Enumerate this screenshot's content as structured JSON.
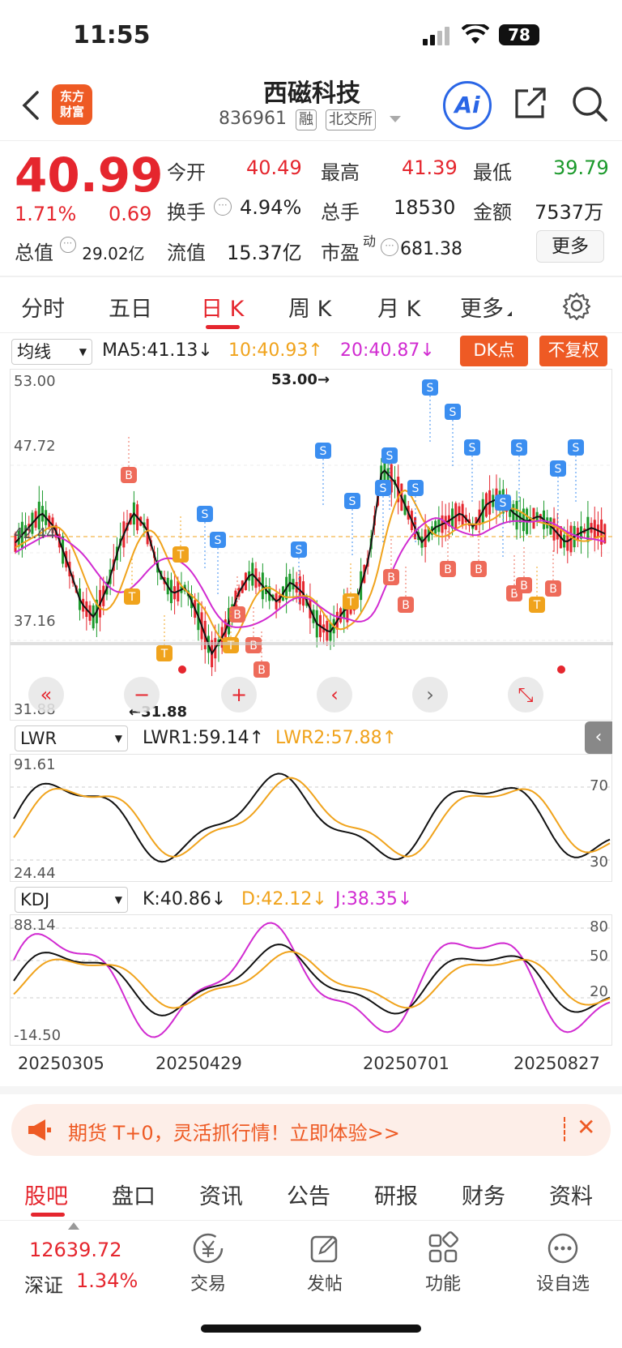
{
  "status": {
    "time": "11:55",
    "battery": "78"
  },
  "nav": {
    "logo_line1": "东方",
    "logo_line2": "财富",
    "title": "西磁科技",
    "code": "836961",
    "tag1": "融",
    "tag2": "北交所",
    "ai_label": "Ai"
  },
  "quote": {
    "price": "40.99",
    "change_pct": "1.71%",
    "change": "0.69",
    "total_value_label": "总值",
    "total_value": "29.02亿",
    "open_label": "今开",
    "open": "40.49",
    "high_label": "最高",
    "high": "41.39",
    "low_label": "最低",
    "low": "39.79",
    "turnover_label": "换手",
    "turnover": "4.94%",
    "volume_label": "总手",
    "volume": "18530",
    "amount_label": "金额",
    "amount": "7537万",
    "float_label": "流值",
    "float_value": "15.37亿",
    "pe_label": "市盈",
    "pe_sup": "动",
    "pe": "681.38",
    "more_button": "更多"
  },
  "tabs": [
    {
      "label": "分时"
    },
    {
      "label": "五日"
    },
    {
      "label": "日 K"
    },
    {
      "label": "周 K"
    },
    {
      "label": "月 K"
    },
    {
      "label": "更多"
    }
  ],
  "main_chart": {
    "indicator": "均线",
    "ma5": "MA5:41.13",
    "ma10": "10:40.93",
    "ma20": "20:40.87",
    "dk_button": "DK点",
    "fq_button": "不复权",
    "y_labels": [
      "53.00",
      "47.72",
      "42.44",
      "37.16",
      "31.88"
    ],
    "max_note": "53.00",
    "min_note": "31.88",
    "colors": {
      "up": "#e5262e",
      "down": "#1c9a2c",
      "ma5": "#111111",
      "ma10": "#f0a31c",
      "ma20": "#d12bd1"
    }
  },
  "lwr": {
    "indicator": "LWR",
    "lwr1": "LWR1:59.14",
    "lwr2": "LWR2:57.88",
    "y_top": "91.61",
    "y_bottom": "24.44",
    "level_high": "70",
    "level_low": "30"
  },
  "kdj": {
    "indicator": "KDJ",
    "k": "K:40.86",
    "d": "D:42.12",
    "j": "J:38.35",
    "y_top": "88.14",
    "y_bottom": "-14.50",
    "l80": "80",
    "l50": "50",
    "l20": "20"
  },
  "dates": [
    "20250305",
    "20250429",
    "20250701",
    "20250827"
  ],
  "banner": {
    "text": "期货 T+0，灵活抓行情！立即体验>>"
  },
  "bottom_tabs": [
    "股吧",
    "盘口",
    "资讯",
    "公告",
    "研报",
    "财务",
    "资料"
  ],
  "dock": {
    "index_value": "12639.72",
    "index_name": "深证",
    "index_change": "1.34%",
    "items": [
      "交易",
      "发帖",
      "功能",
      "设自选"
    ]
  }
}
